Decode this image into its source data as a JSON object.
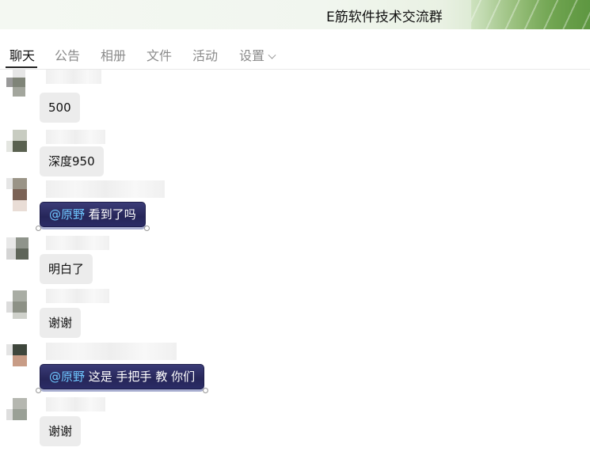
{
  "window": {
    "title": "E筋软件技术交流群"
  },
  "tabs": [
    {
      "label": "聊天",
      "active": true
    },
    {
      "label": "公告",
      "active": false
    },
    {
      "label": "相册",
      "active": false
    },
    {
      "label": "文件",
      "active": false
    },
    {
      "label": "活动",
      "active": false
    },
    {
      "label": "设置",
      "active": false
    }
  ],
  "messages": [
    {
      "text": "500"
    },
    {
      "text": "深度950"
    },
    {
      "mention": "@原野",
      "text": " 看到了吗"
    },
    {
      "text": "明白了"
    },
    {
      "text": "谢谢"
    },
    {
      "mention": "@原野",
      "text": " 这是 手把手 教 你们"
    },
    {
      "text": "谢谢"
    }
  ],
  "colors": {
    "accent_mention": "#6ec6ff",
    "special_bubble": "#2a2b63"
  },
  "icons": {
    "settings_dropdown": "chevron-down-icon"
  }
}
